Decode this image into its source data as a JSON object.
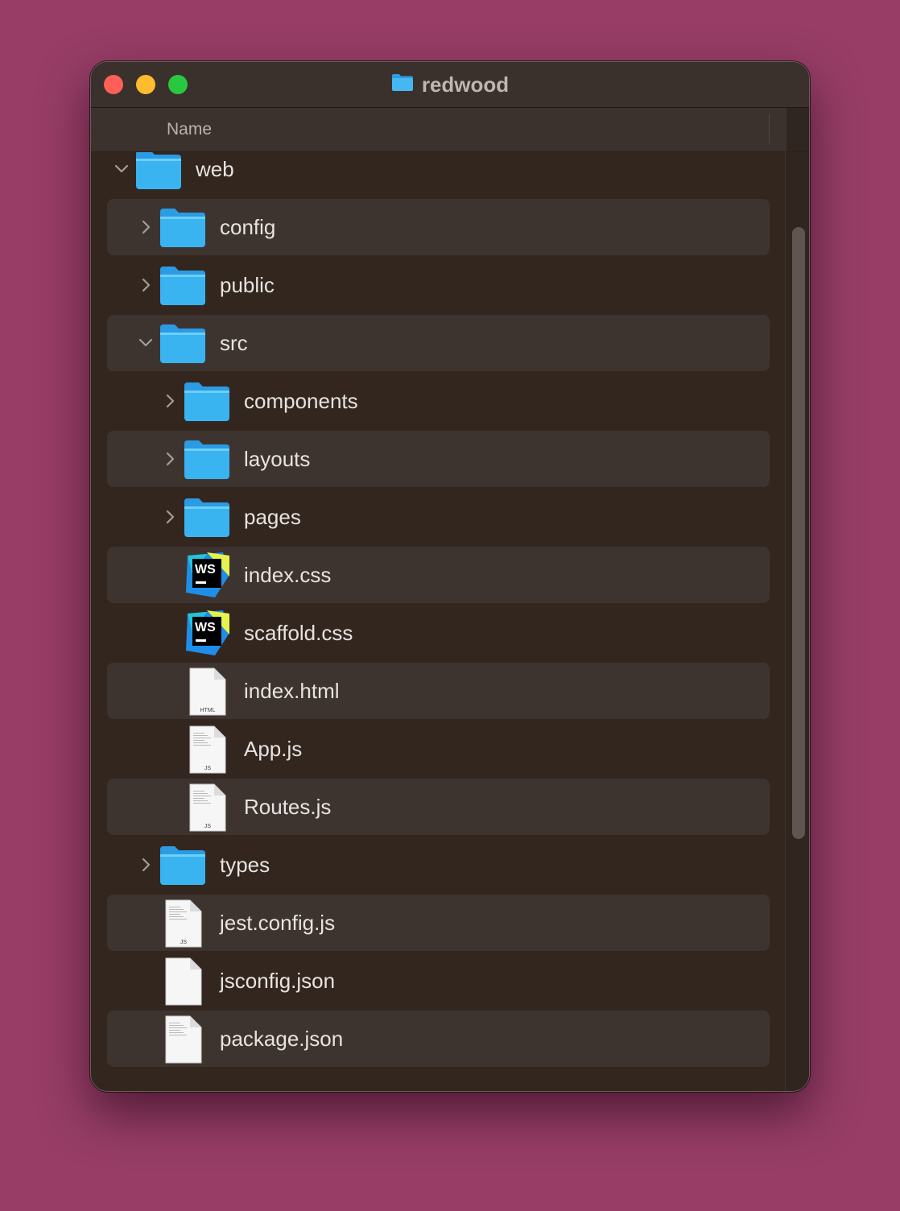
{
  "window": {
    "title": "redwood",
    "title_icon": "folder-icon"
  },
  "header": {
    "name_column": "Name"
  },
  "colors": {
    "background": "#973d66",
    "window": "#33261f",
    "folder": "#3ab3f1",
    "close": "#fe5f57",
    "minimize": "#febc2e",
    "zoom": "#28c840"
  },
  "rows": [
    {
      "label": "web",
      "kind": "folder",
      "depth": 0,
      "expanded": true,
      "icon": "folder-icon"
    },
    {
      "label": "config",
      "kind": "folder",
      "depth": 1,
      "expanded": false,
      "icon": "folder-icon"
    },
    {
      "label": "public",
      "kind": "folder",
      "depth": 1,
      "expanded": false,
      "icon": "folder-icon"
    },
    {
      "label": "src",
      "kind": "folder",
      "depth": 1,
      "expanded": true,
      "icon": "folder-icon"
    },
    {
      "label": "components",
      "kind": "folder",
      "depth": 2,
      "expanded": false,
      "icon": "folder-icon"
    },
    {
      "label": "layouts",
      "kind": "folder",
      "depth": 2,
      "expanded": false,
      "icon": "folder-icon"
    },
    {
      "label": "pages",
      "kind": "folder",
      "depth": 2,
      "expanded": false,
      "icon": "folder-icon"
    },
    {
      "label": "index.css",
      "kind": "webstorm",
      "depth": 2,
      "icon": "webstorm-file-icon",
      "badge": "WS"
    },
    {
      "label": "scaffold.css",
      "kind": "webstorm",
      "depth": 2,
      "icon": "webstorm-file-icon",
      "badge": "WS"
    },
    {
      "label": "index.html",
      "kind": "doc",
      "depth": 2,
      "icon": "html-file-icon",
      "badge": "HTML"
    },
    {
      "label": "App.js",
      "kind": "doc",
      "depth": 2,
      "icon": "js-file-icon",
      "badge": "JS"
    },
    {
      "label": "Routes.js",
      "kind": "doc",
      "depth": 2,
      "icon": "js-file-icon",
      "badge": "JS"
    },
    {
      "label": "types",
      "kind": "folder",
      "depth": 1,
      "expanded": false,
      "icon": "folder-icon"
    },
    {
      "label": "jest.config.js",
      "kind": "doc",
      "depth": 1,
      "icon": "js-file-icon",
      "badge": "JS"
    },
    {
      "label": "jsconfig.json",
      "kind": "doc",
      "depth": 1,
      "icon": "json-file-icon",
      "badge": ""
    },
    {
      "label": "package.json",
      "kind": "doc",
      "depth": 1,
      "icon": "json-file-icon",
      "badge": ""
    }
  ]
}
